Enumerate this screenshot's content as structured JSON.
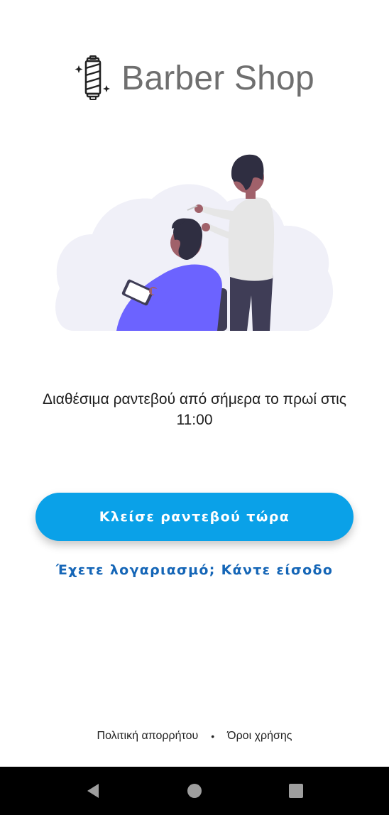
{
  "app": {
    "title": "Barber Shop"
  },
  "icons": {
    "logo": "barber-pole-icon",
    "back": "back-triangle-icon",
    "home": "home-circle-icon",
    "recents": "recents-square-icon"
  },
  "colors": {
    "accent": "#0aa1e8",
    "link": "#1566b7",
    "logo_text": "#6f6f6f",
    "illustration_purple": "#6c63ff"
  },
  "main": {
    "tagline": "Διαθέσιμα ραντεβού από σήμερα το πρωί στις 11:00",
    "book_button": "Κλείσε ραντεβού τώρα",
    "login_link": "Έχετε λογαριασμό; Κάντε είσοδο"
  },
  "footer": {
    "privacy": "Πολιτική απορρήτου",
    "separator": "•",
    "terms": "Όροι χρήσης"
  }
}
